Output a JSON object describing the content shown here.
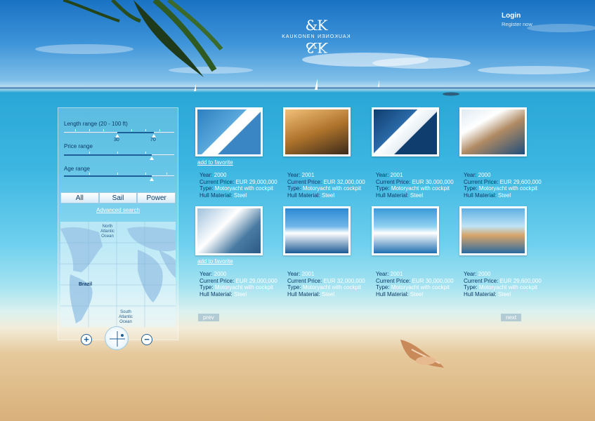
{
  "brand": {
    "mark": "&K",
    "name": "KAUKONEN",
    "name_mirrored": "KAUKONEN"
  },
  "auth": {
    "login": "Login",
    "register": "Register now"
  },
  "filters": {
    "length": {
      "label": "Length range (20 - 100 ft)",
      "min_value": "30",
      "max_value": "70"
    },
    "price": {
      "label": "Price range"
    },
    "age": {
      "label": "Age range"
    },
    "types": [
      "All",
      "Sail",
      "Power"
    ],
    "advanced": "Advanced search"
  },
  "map": {
    "labels": [
      "North Atlantic Ocean",
      "Brazil",
      "South Atlantic Ocean"
    ]
  },
  "labels": {
    "favorite": "add to favorite",
    "year": "Year:",
    "price": "Current Price:",
    "type": "Type:",
    "hull": "Hull Material:"
  },
  "listings": [
    {
      "year": "2000",
      "price": "EUR 29,000,000",
      "type": "Motoryacht with cockpit",
      "hull": "Steel",
      "favorite_link": true
    },
    {
      "year": "2001",
      "price": "EUR 32,000,000",
      "type": "Motoryacht with cockpit",
      "hull": "Steel",
      "favorite_link": false
    },
    {
      "year": "2001",
      "price": "EUR 30,000,000",
      "type": "Motoryacht with cockpit",
      "hull": "Steel",
      "favorite_link": false
    },
    {
      "year": "2000",
      "price": "EUR 29,600,000",
      "type": "Motoryacht with cockpit",
      "hull": "Steel",
      "favorite_link": false
    },
    {
      "year": "2000",
      "price": "EUR 29,000,000",
      "type": "Motoryacht with cockpit",
      "hull": "Steel",
      "favorite_link": true
    },
    {
      "year": "2001",
      "price": "EUR 32,000,000",
      "type": "Motoryacht with cockpit",
      "hull": "Steel",
      "favorite_link": false
    },
    {
      "year": "2001",
      "price": "EUR 30,000,000",
      "type": "Motoryacht with cockpit",
      "hull": "Steel",
      "favorite_link": false
    },
    {
      "year": "2000",
      "price": "EUR 29,600,000",
      "type": "Motoryacht with cockpit",
      "hull": "Steel",
      "favorite_link": false
    }
  ],
  "pagination": {
    "prev": "prev",
    "next": "next"
  },
  "icons": {
    "zoom_in": "plus-icon",
    "zoom_out": "minus-icon",
    "compass": "compass-icon"
  },
  "colors": {
    "accent": "#1e5f97",
    "text_dark": "#0d3a66",
    "text_light": "#ffffff"
  }
}
